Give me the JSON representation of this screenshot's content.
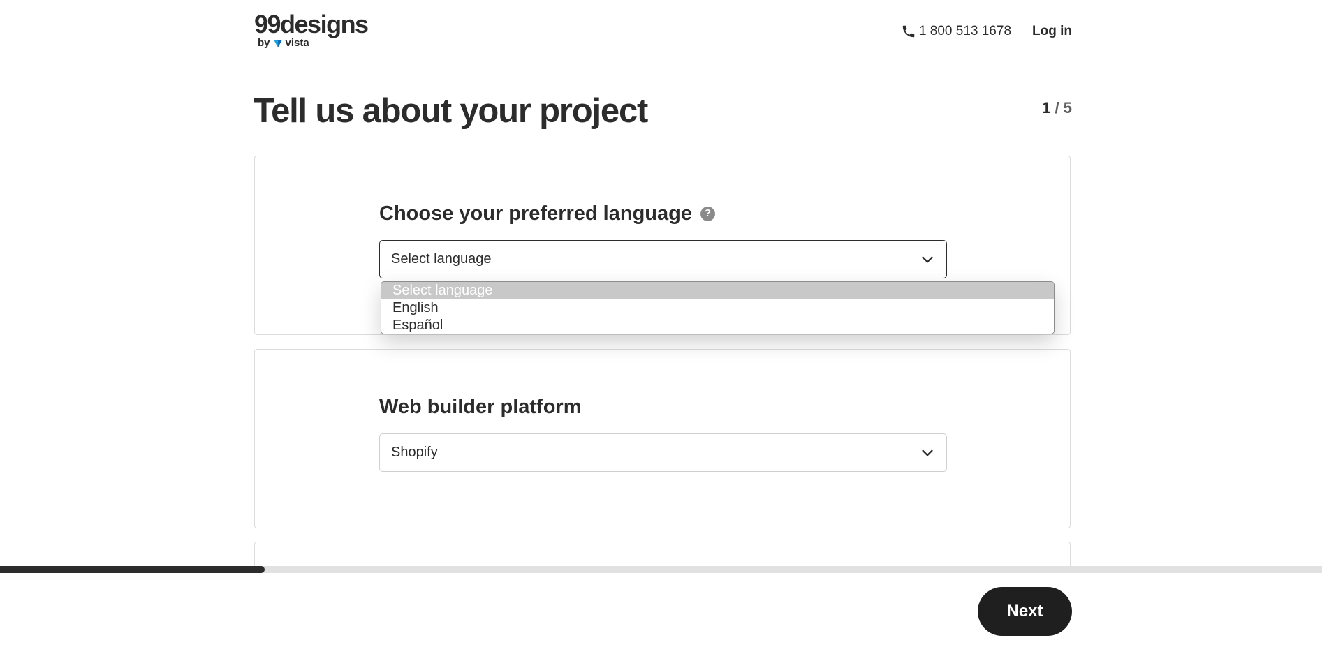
{
  "header": {
    "logo_text": "99designs",
    "logo_by": "by",
    "logo_vista": "vista",
    "phone_icon": "phone-icon",
    "phone_number": "1 800 513 1678",
    "login_label": "Log in"
  },
  "main": {
    "title": "Tell us about your project",
    "step_current": "1",
    "step_total": "/ 5"
  },
  "language_card": {
    "heading": "Choose your preferred language",
    "help_icon": "question-circle-icon",
    "help_glyph": "?",
    "select_value": "Select language",
    "options": [
      "Select language",
      "English",
      "Español"
    ],
    "highlighted_option": "Select language"
  },
  "platform_card": {
    "heading": "Web builder platform",
    "select_value": "Shopify"
  },
  "footer": {
    "progress": 0.2,
    "next_label": "Next"
  },
  "colors": {
    "text": "#2c2c2c",
    "button_bg": "#1f1f1f",
    "option_highlight": "#c8c8c8",
    "vista_blue": "#1aa0e6"
  }
}
